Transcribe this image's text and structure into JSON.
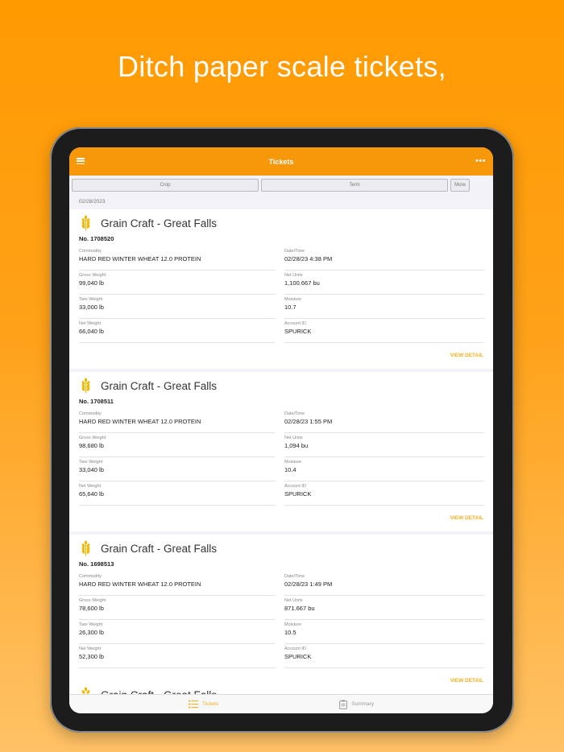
{
  "headline": "Ditch paper scale tickets,",
  "colors": {
    "accent": "#f7970a",
    "link": "#f0b020"
  },
  "navbar": {
    "title": "Tickets",
    "menu_icon": "hamburger-icon",
    "more_icon": "ellipsis-icon"
  },
  "filters": {
    "crop": "Crop",
    "term": "Term",
    "more": "More"
  },
  "date_header": "02/28/2023",
  "tickets": [
    {
      "elevator": "Grain Craft - Great Falls",
      "number": "No. 1708520",
      "labels": {
        "commodity": "Commodity",
        "datetime": "Date/Time",
        "gross": "Gross Weight",
        "net_units": "Net Units",
        "tare": "Tare Weight",
        "moisture": "Moisture",
        "net_weight": "Net Weight",
        "account": "Account ID"
      },
      "commodity": "HARD RED WINTER WHEAT 12.0 PROTEIN",
      "datetime": "02/28/23 4:38 PM",
      "gross": "99,040 lb",
      "net_units": "1,100.667 bu",
      "tare": "33,000 lb",
      "moisture": "10.7",
      "net_weight": "66,040 lb",
      "account": "SPURICK",
      "action": "VIEW DETAIL"
    },
    {
      "elevator": "Grain Craft - Great Falls",
      "number": "No. 1708511",
      "labels": {
        "commodity": "Commodity",
        "datetime": "Date/Time",
        "gross": "Gross Weight",
        "net_units": "Net Units",
        "tare": "Tare Weight",
        "moisture": "Moisture",
        "net_weight": "Net Weight",
        "account": "Account ID"
      },
      "commodity": "HARD RED WINTER WHEAT 12.0 PROTEIN",
      "datetime": "02/28/23 1:55 PM",
      "gross": "98,680 lb",
      "net_units": "1,094 bu",
      "tare": "33,040 lb",
      "moisture": "10.4",
      "net_weight": "65,640 lb",
      "account": "SPURICK",
      "action": "VIEW DETAIL"
    },
    {
      "elevator": "Grain Craft - Great Falls",
      "number": "No. 1698513",
      "labels": {
        "commodity": "Commodity",
        "datetime": "Date/Time",
        "gross": "Gross Weight",
        "net_units": "Net Units",
        "tare": "Tare Weight",
        "moisture": "Moisture",
        "net_weight": "Net Weight",
        "account": "Account ID"
      },
      "commodity": "HARD RED WINTER WHEAT 12.0 PROTEIN",
      "datetime": "02/28/23 1:49 PM",
      "gross": "78,600 lb",
      "net_units": "871.667 bu",
      "tare": "26,300 lb",
      "moisture": "10.5",
      "net_weight": "52,300 lb",
      "account": "SPURICK",
      "action": "VIEW DETAIL"
    }
  ],
  "peek_ticket": {
    "elevator": "Grain Craft - Great Falls"
  },
  "tabbar": {
    "tickets": "Tickets",
    "summary": "Summary",
    "tickets_icon": "list-icon",
    "summary_icon": "clipboard-icon"
  }
}
